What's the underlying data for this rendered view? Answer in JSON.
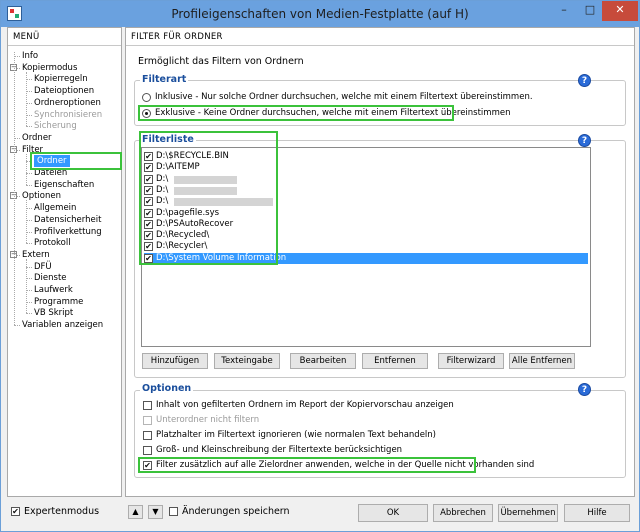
{
  "window": {
    "title": "Profileigenschaften von Medien-Festplatte (auf H)",
    "minimize": "–",
    "maximize": "□",
    "close": "✕"
  },
  "menu": {
    "header": "MENÜ",
    "items": [
      {
        "label": "Info",
        "level": 0
      },
      {
        "label": "Kopiermodus",
        "level": 0,
        "expander": "−"
      },
      {
        "label": "Kopierregeln",
        "level": 1
      },
      {
        "label": "Dateioptionen",
        "level": 1
      },
      {
        "label": "Ordneroptionen",
        "level": 1
      },
      {
        "label": "Synchronisieren",
        "level": 1,
        "disabled": true
      },
      {
        "label": "Sicherung",
        "level": 1,
        "disabled": true
      },
      {
        "label": "Ordner",
        "level": 0
      },
      {
        "label": "Filter",
        "level": 0,
        "expander": "−"
      },
      {
        "label": "Ordner",
        "level": 1,
        "selected": true
      },
      {
        "label": "Dateien",
        "level": 1
      },
      {
        "label": "Eigenschaften",
        "level": 1
      },
      {
        "label": "Optionen",
        "level": 0,
        "expander": "−"
      },
      {
        "label": "Allgemein",
        "level": 1
      },
      {
        "label": "Datensicherheit",
        "level": 1
      },
      {
        "label": "Profilverkettung",
        "level": 1
      },
      {
        "label": "Protokoll",
        "level": 1
      },
      {
        "label": "Extern",
        "level": 0,
        "expander": "−"
      },
      {
        "label": "DFÜ",
        "level": 1
      },
      {
        "label": "Dienste",
        "level": 1
      },
      {
        "label": "Laufwerk",
        "level": 1
      },
      {
        "label": "Programme",
        "level": 1
      },
      {
        "label": "VB Skript",
        "level": 1
      },
      {
        "label": "Variablen anzeigen",
        "level": 0
      }
    ]
  },
  "main": {
    "header": "FILTER FÜR ORDNER",
    "subtitle": "Ermöglicht das Filtern von Ordnern",
    "filterart": {
      "title": "Filterart",
      "help": "?",
      "options": [
        {
          "label": "Inklusive - Nur solche Ordner durchsuchen, welche mit einem Filtertext übereinstimmen.",
          "selected": false
        },
        {
          "label": "Exklusive - Keine Ordner durchsuchen, welche mit einem Filtertext übereinstimmen",
          "selected": true
        }
      ]
    },
    "filterliste": {
      "title": "Filterliste",
      "help": "?",
      "check": "✔",
      "rows": [
        {
          "text": "D:\\$RECYCLE.BIN",
          "checked": true
        },
        {
          "text": "D:\\AITEMP",
          "checked": true
        },
        {
          "text": "D:\\",
          "checked": true,
          "redacted": 0.14
        },
        {
          "text": "D:\\",
          "checked": true,
          "redacted": 0.14
        },
        {
          "text": "D:\\",
          "checked": true,
          "redacted": 0.22
        },
        {
          "text": "D:\\pagefile.sys",
          "checked": true
        },
        {
          "text": "D:\\PSAutoRecover",
          "checked": true
        },
        {
          "text": "D:\\Recycled\\",
          "checked": true
        },
        {
          "text": "D:\\Recycler\\",
          "checked": true
        },
        {
          "text": "D:\\System Volume Information",
          "checked": true,
          "selected": true
        }
      ],
      "buttons": [
        "Hinzufügen",
        "Texteingabe",
        "Bearbeiten",
        "Entfernen",
        "Filterwizard",
        "Alle Entfernen"
      ]
    },
    "optionen": {
      "title": "Optionen",
      "help": "?",
      "items": [
        {
          "label": "Inhalt von gefilterten Ordnern im Report der Kopiervorschau anzeigen",
          "checked": false
        },
        {
          "label": "Unterordner nicht filtern",
          "checked": false,
          "disabled": true
        },
        {
          "label": "Platzhalter im Filtertext ignorieren (wie normalen Text behandeln)",
          "checked": false
        },
        {
          "label": "Groß- und Kleinschreibung der Filtertexte berücksichtigen",
          "checked": false
        },
        {
          "label": "Filter zusätzlich auf alle Zielordner anwenden, welche in der Quelle nicht vorhanden sind",
          "checked": true
        }
      ]
    }
  },
  "footer": {
    "expertenmodus": "Expertenmodus",
    "expertenmodus_checked": true,
    "up": "▲",
    "down": "▼",
    "aenderungen": "Änderungen speichern",
    "aenderungen_checked": false,
    "ok": "OK",
    "abbrechen": "Abbrechen",
    "uebernehmen": "Übernehmen",
    "hilfe": "Hilfe"
  },
  "colors": {
    "titlebar": "#6aa1df",
    "selection": "#3399ff",
    "group_title": "#1a4e9c",
    "highlight_box": "#3bc23b",
    "close_button": "#c74b3b"
  }
}
